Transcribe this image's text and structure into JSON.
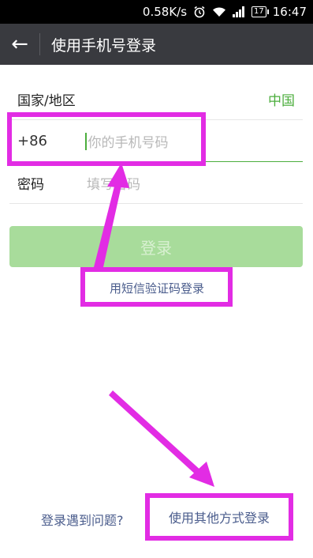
{
  "status_bar": {
    "network_speed": "0.58K/s",
    "alarm_icon": "alarm-clock-icon",
    "wifi_icon": "wifi-icon",
    "signal_icon": "signal-bars-icon",
    "battery_level": "17",
    "time": "16:47"
  },
  "titlebar": {
    "back_icon": "←",
    "title": "使用手机号登录"
  },
  "form": {
    "country_label": "国家/地区",
    "country_value": "中国",
    "phone_prefix": "+86",
    "phone_placeholder": "你的手机号码",
    "password_label": "密码",
    "password_placeholder": "填写密码"
  },
  "actions": {
    "login_button": "登录",
    "sms_login_link": "用短信验证码登录",
    "problem_link": "登录遇到问题?",
    "other_login_link": "使用其他方式登录"
  },
  "colors": {
    "accent": "#4cae3d",
    "button_disabled": "#a8dc9b",
    "link": "#4a5c8c",
    "annotation": "#e22ce4"
  }
}
